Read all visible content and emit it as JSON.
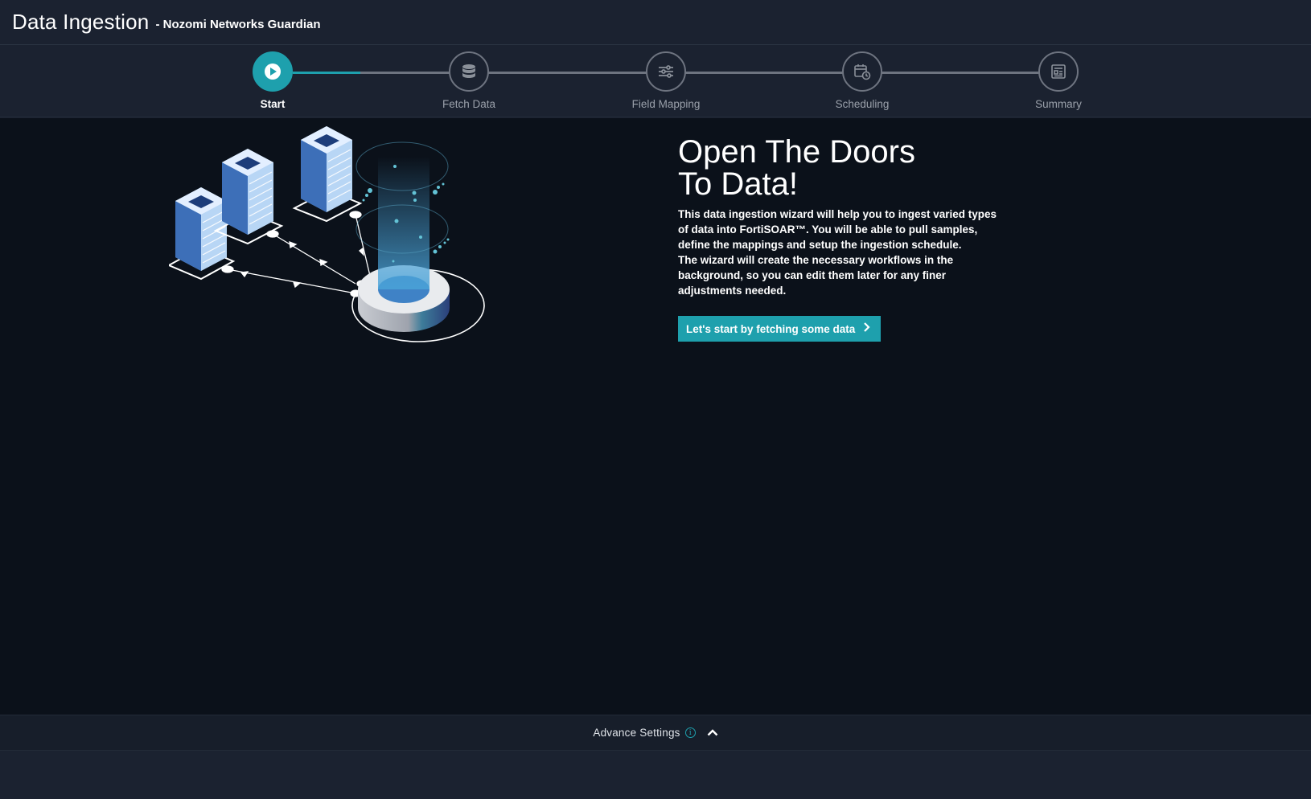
{
  "header": {
    "title": "Data Ingestion",
    "subtitle": "- Nozomi Networks Guardian"
  },
  "stepper": {
    "steps": [
      {
        "label": "Start",
        "icon": "play-icon",
        "state": "active"
      },
      {
        "label": "Fetch Data",
        "icon": "database-icon",
        "state": "pending"
      },
      {
        "label": "Field Mapping",
        "icon": "sliders-icon",
        "state": "pending"
      },
      {
        "label": "Scheduling",
        "icon": "calendar-clock-icon",
        "state": "pending"
      },
      {
        "label": "Summary",
        "icon": "summary-document-icon",
        "state": "pending"
      }
    ]
  },
  "hero": {
    "heading": "Open The Doors\nTo Data!",
    "paragraph1": "This data ingestion wizard will help you to ingest varied types of data into FortiSOAR™. You will be able to pull samples, define the mappings and setup the ingestion schedule.",
    "paragraph2": "The wizard will create the necessary workflows in the background, so you can edit them later for any finer adjustments needed.",
    "cta_label": "Let's start by fetching some data"
  },
  "advance_settings": {
    "label": "Advance Settings"
  },
  "colors": {
    "accent": "#1ea0ad",
    "background": "#0b111a",
    "panel": "#1b2230"
  }
}
